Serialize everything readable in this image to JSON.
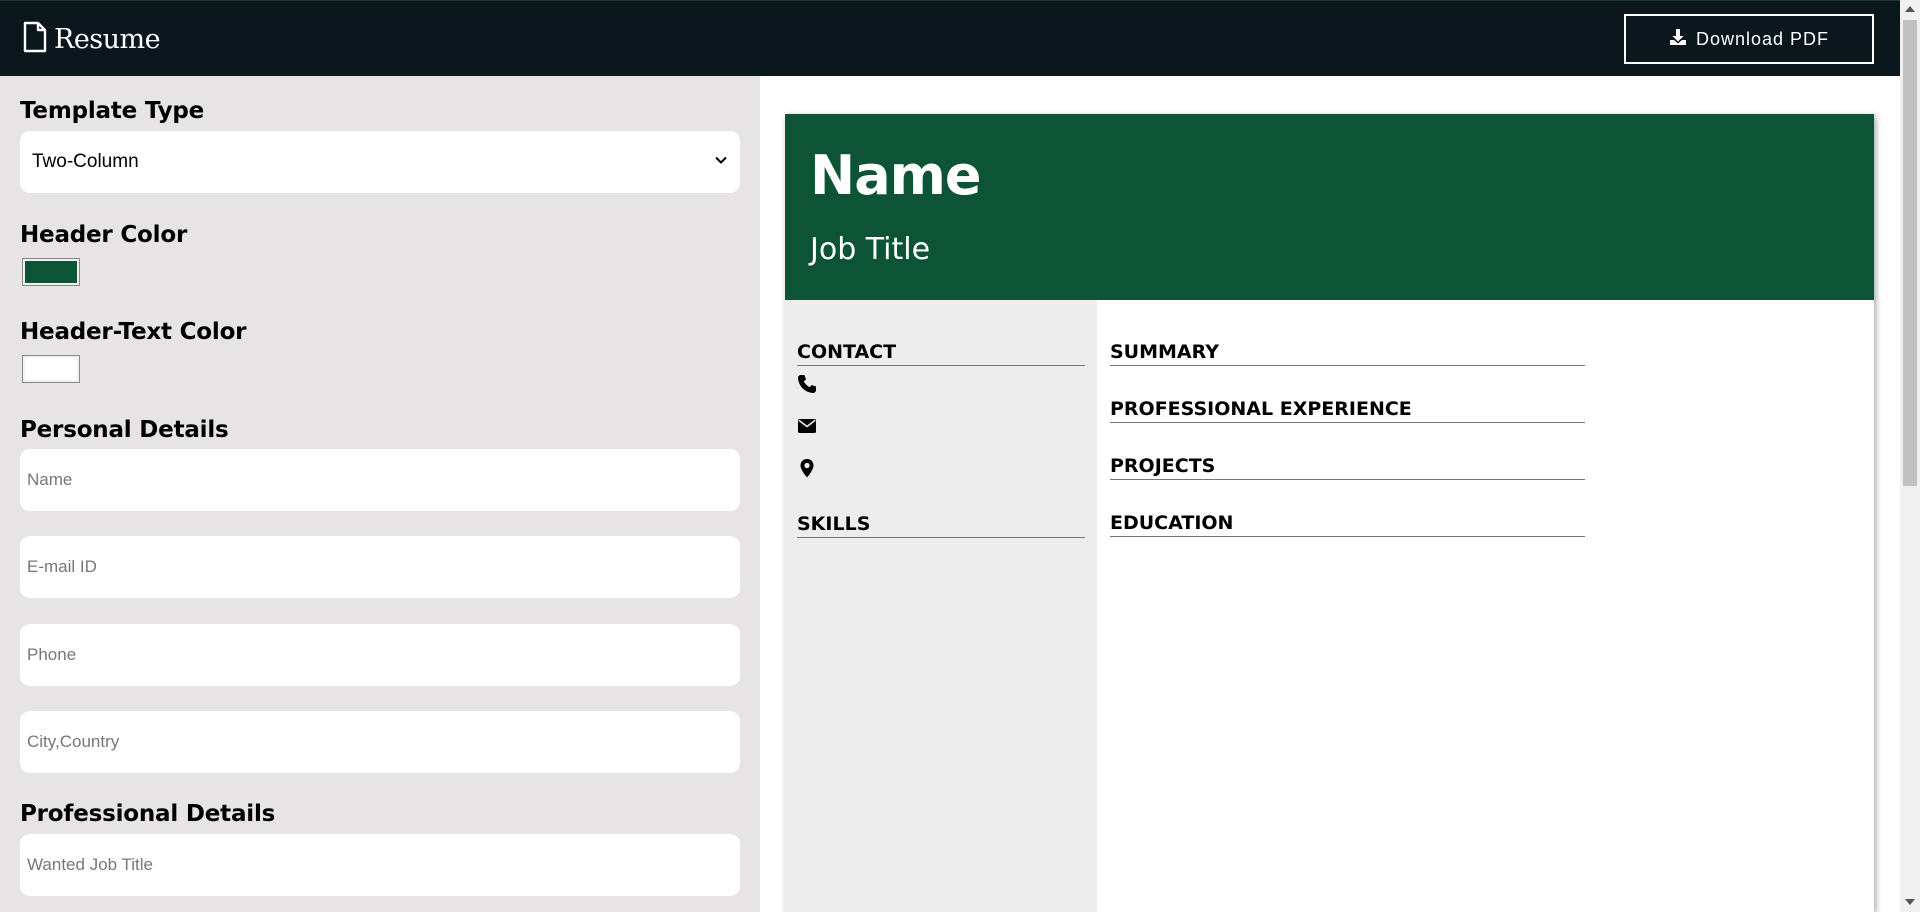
{
  "app": {
    "brand": "Resume",
    "download_label": "Download PDF"
  },
  "form": {
    "template_type_label": "Template Type",
    "template_type_value": "Two-Column",
    "header_color_label": "Header Color",
    "header_color_value": "#0c5435",
    "header_text_color_label": "Header-Text Color",
    "header_text_color_value": "#ffffff",
    "personal_details_label": "Personal Details",
    "name_placeholder": "Name",
    "email_placeholder": "E-mail ID",
    "phone_placeholder": "Phone",
    "location_placeholder": "City,Country",
    "professional_details_label": "Professional Details",
    "job_title_placeholder": "Wanted Job Title"
  },
  "resume": {
    "name": "Name",
    "job_title": "Job Title",
    "sidebar_sections": {
      "contact": "CONTACT",
      "skills": "SKILLS"
    },
    "main_sections": {
      "summary": "SUMMARY",
      "experience": "PROFESSIONAL EXPERIENCE",
      "projects": "PROJECTS",
      "education": "EDUCATION"
    },
    "contact_icons": [
      "phone-icon",
      "envelope-icon",
      "map-marker-icon"
    ]
  },
  "colors": {
    "topbar": "#0b171c",
    "form_bg": "#e6e4e5",
    "resume_sidebar": "#ededed"
  }
}
